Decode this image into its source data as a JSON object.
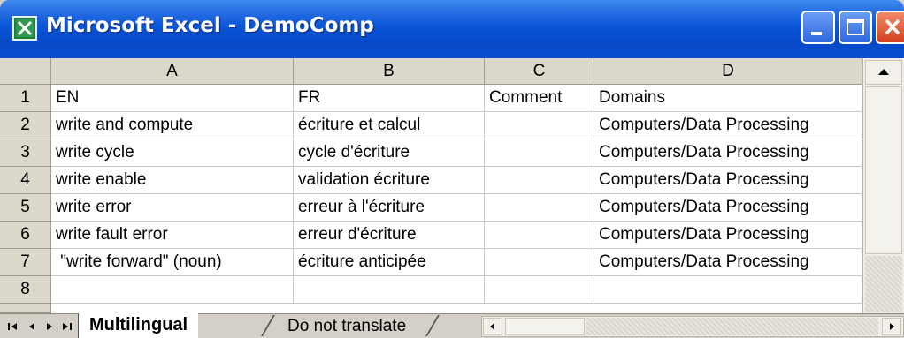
{
  "window": {
    "title": "Microsoft Excel - DemoComp",
    "icon": "excel-app-icon",
    "controls": [
      "minimize-icon",
      "maximize-icon",
      "close-icon"
    ]
  },
  "sheet": {
    "columns": [
      "A",
      "B",
      "C",
      "D"
    ],
    "rows": [
      {
        "num": "1",
        "cells": [
          "EN",
          "FR",
          "Comment",
          "Domains"
        ]
      },
      {
        "num": "2",
        "cells": [
          "write and compute",
          "écriture et calcul",
          "",
          "Computers/Data Processing"
        ]
      },
      {
        "num": "3",
        "cells": [
          "write cycle",
          "cycle d'écriture",
          "",
          "Computers/Data Processing"
        ]
      },
      {
        "num": "4",
        "cells": [
          "write enable",
          "validation écriture",
          "",
          "Computers/Data Processing"
        ]
      },
      {
        "num": "5",
        "cells": [
          "write error",
          "erreur à l'écriture",
          "",
          "Computers/Data Processing"
        ]
      },
      {
        "num": "6",
        "cells": [
          "write fault error",
          "erreur d'écriture",
          "",
          "Computers/Data Processing"
        ]
      },
      {
        "num": "7",
        "cells": [
          " \"write forward\" (noun)",
          "écriture anticipée",
          "",
          "Computers/Data Processing"
        ]
      },
      {
        "num": "8",
        "cells": [
          "",
          "",
          "",
          ""
        ]
      }
    ]
  },
  "sheet_tabs": {
    "active": "Multilingual",
    "other": "Do not translate",
    "nav_icons": [
      "first-sheet-icon",
      "prev-sheet-icon",
      "next-sheet-icon",
      "last-sheet-icon"
    ]
  },
  "colors": {
    "titlebar": "#0a55d8",
    "header_bg": "#dcd8cc",
    "gridline": "#c8c8c8"
  }
}
